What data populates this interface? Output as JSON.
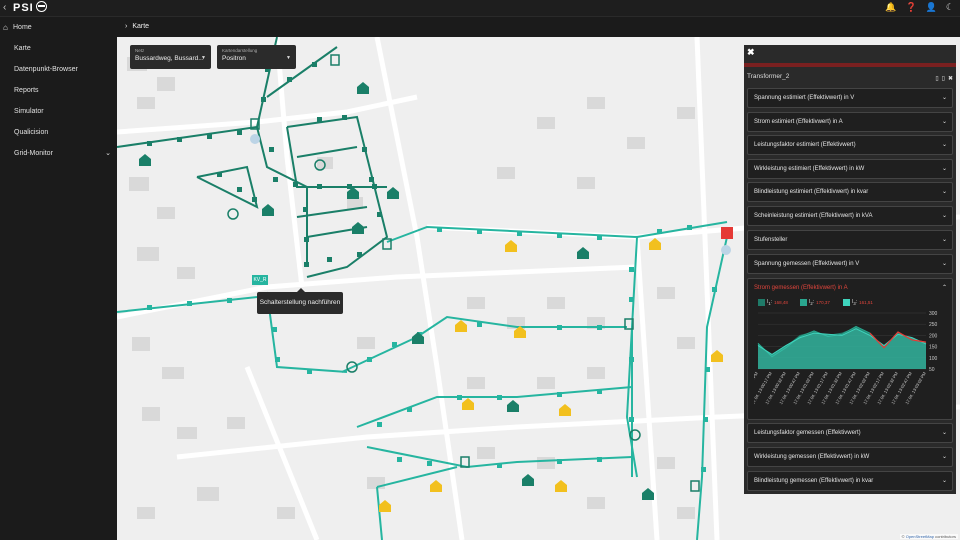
{
  "topbar": {
    "logo_text": "PSI",
    "icons": [
      "bell-icon",
      "help-icon",
      "user-icon",
      "moon-icon"
    ]
  },
  "sidebar": {
    "items": [
      {
        "label": "Home",
        "icon": "home-icon"
      },
      {
        "label": "Karte"
      },
      {
        "label": "Datenpunkt-Browser"
      },
      {
        "label": "Reports"
      },
      {
        "label": "Simulator"
      },
      {
        "label": "Qualicision"
      },
      {
        "label": "Grid-Monitor",
        "has_children": true
      }
    ]
  },
  "breadcrumb": {
    "label": "Karte"
  },
  "map": {
    "netz": {
      "label": "Netz",
      "value": "Bussardweg, Bussard..."
    },
    "karte": {
      "label": "Kartendarstellung",
      "value": "Positron"
    },
    "tooltip": "Schalterstellung nachführen",
    "kv_label": "KV_R",
    "attribution_link": "OpenStreetMap",
    "attribution_text": "contributors",
    "colors": {
      "line": "#26b5a0",
      "node": "#1a7f68",
      "house_green": "#1a7f68",
      "house_yellow": "#f2c01e",
      "alarm": "#e53935",
      "bg": "#efefef"
    }
  },
  "panel": {
    "title": "Transformer_2",
    "accordions_top": [
      "Spannung estimiert (Effektivwert) in V",
      "Strom estimiert (Effektivwert) in A",
      "Leistungsfaktor estimiert (Effektivwert)",
      "Wirkleistung estimiert (Effektivwert) in kW",
      "Blindleistung estimiert (Effektivwert) in kvar",
      "Scheinleistung estimiert (Effektivwert) in kVA",
      "Stufensteller",
      "Spannung gemessen (Effektivwert) in V"
    ],
    "open_accordion": {
      "title": "Strom gemessen (Effektivwert) in A",
      "legend": [
        {
          "name": "I",
          "sub": "1",
          "value": "168,48",
          "color": "#1f7a68"
        },
        {
          "name": "I",
          "sub": "2",
          "value": "170,37",
          "color": "#2aa68f"
        },
        {
          "name": "I",
          "sub": "3",
          "value": "161,51",
          "color": "#3fd4bd"
        }
      ]
    },
    "accordions_bottom": [
      "Leistungsfaktor gemessen (Effektivwert)",
      "Wirkleistung gemessen (Effektivwert) in kW",
      "Blindleistung gemessen (Effektivwert) in kvar"
    ]
  },
  "chart_data": {
    "type": "area",
    "title": "Strom gemessen (Effektivwert) in A",
    "x": [
      "17.04. 13:00:02 PM",
      "17.04. 13:00:17 PM",
      "17.04. 13:00:32 PM",
      "17.04. 13:00:47 PM",
      "17.04. 13:01:02 PM",
      "17.04. 13:01:17 PM",
      "17.04. 13:01:32 PM",
      "17.04. 13:01:47 PM",
      "17.04. 13:02:02 PM",
      "17.04. 13:02:17 PM",
      "17.04. 13:02:32 PM",
      "17.04. 13:02:47 PM",
      "17.04. 13:03:02 PM"
    ],
    "ylim": [
      50,
      300
    ],
    "yticks": [
      50,
      100,
      150,
      200,
      250,
      300
    ],
    "series": [
      {
        "name": "I1",
        "values": [
          160,
          110,
          150,
          200,
          215,
          200,
          210,
          235,
          205,
          150,
          210,
          185,
          168
        ]
      },
      {
        "name": "I2",
        "values": [
          165,
          105,
          145,
          195,
          220,
          195,
          205,
          240,
          210,
          145,
          215,
          180,
          170
        ]
      },
      {
        "name": "I3",
        "values": [
          155,
          115,
          155,
          190,
          210,
          205,
          200,
          230,
          200,
          155,
          205,
          190,
          162
        ]
      }
    ]
  }
}
